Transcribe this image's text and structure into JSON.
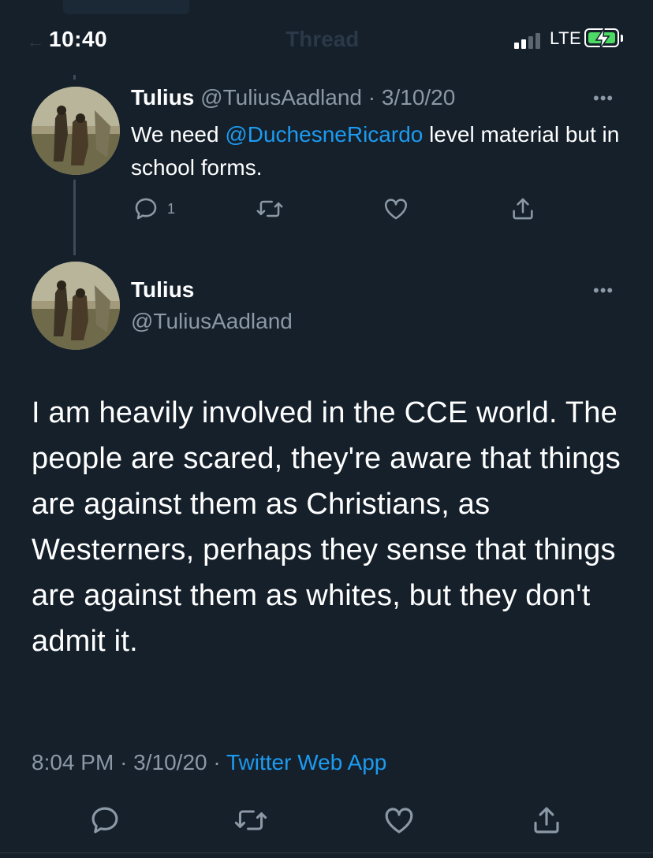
{
  "status_bar": {
    "time": "10:40",
    "network": "LTE",
    "nav_title_ghost": "Thread",
    "battery_charging": true
  },
  "reply_tweet": {
    "display_name": "Tulius",
    "handle": "@TuliusAadland",
    "separator": "·",
    "date": "3/10/20",
    "text_before": "We need ",
    "mention": "@DuchesneRicardo",
    "text_after": " level material but in school forms.",
    "reply_count": "1",
    "more_label": "•••"
  },
  "main_tweet": {
    "display_name": "Tulius",
    "handle": "@TuliusAadland",
    "text": "I am heavily involved in the CCE world. The people are scared, they're aware that things are against them as Christians, as Westerners, perhaps they sense that things are against them as whites, but they don't admit it.",
    "time": "8:04 PM",
    "separator": "·",
    "date": "3/10/20",
    "source_separator": "·",
    "source": "Twitter Web App",
    "more_label": "•••"
  },
  "icons": {
    "reply": "reply-icon",
    "retweet": "retweet-icon",
    "like": "heart-icon",
    "share": "share-icon",
    "more": "more-icon"
  },
  "colors": {
    "background": "#15202b",
    "text": "#ffffff",
    "secondary": "#8b98a5",
    "link": "#1d9bf0",
    "battery": "#4cd964"
  }
}
